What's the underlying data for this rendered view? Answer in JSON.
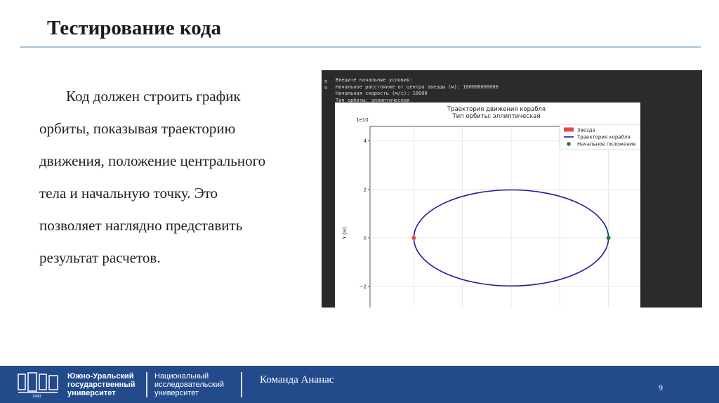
{
  "slide": {
    "title": "Тестирование кода",
    "body_lines": [
      "Код  должен строить график",
      "орбиты, показывая траекторию",
      "движения, положение центрального",
      "тела и начальную точку. Это",
      "позволяет наглядно представить",
      "результат расчетов."
    ]
  },
  "console": {
    "lines": [
      "Введите начальные условия:",
      "Начальное расстояние от центра звезды (м): 100000000000",
      "Начальная скорость (м/с): 10000",
      "Тип орбиты: эллиптическая"
    ]
  },
  "chart_data": {
    "type": "line",
    "title": "Траектория движения корабля",
    "subtitle": "Тип орбиты: эллиптическая",
    "ylabel": "Y (м)",
    "y_scale_label": "1e10",
    "y_ticks": [
      "4",
      "2",
      "0",
      "−2"
    ],
    "ylim": [
      -3.1,
      4.6
    ],
    "xlim": [
      -1.45,
      1.45
    ],
    "grid": true,
    "legend_position": "top-right",
    "series": [
      {
        "name": "Звезда",
        "kind": "marker",
        "x": -1.0,
        "y": 0,
        "color": "#e8464a"
      },
      {
        "name": "Траектория корабля",
        "kind": "ellipse",
        "center_x": 0,
        "center_y": 0,
        "semi_major": 1.0,
        "semi_minor": 1.98,
        "color": "#1c1c9e"
      },
      {
        "name": "Начальное положение",
        "kind": "marker",
        "x": 1.0,
        "y": 0,
        "color": "#1e7d32"
      }
    ]
  },
  "footer": {
    "university_lines": [
      "Южно-Уральский",
      "государственный",
      "университет"
    ],
    "research_lines": [
      "Национальный",
      "исследовательский",
      "университет"
    ],
    "logo_year": "1943",
    "team": "Команда Ананас",
    "page_number": "9"
  },
  "colors": {
    "footer_bg": "#234b8c",
    "title_rule": "#a9c2d6",
    "console_bg": "#2b2b2b"
  }
}
